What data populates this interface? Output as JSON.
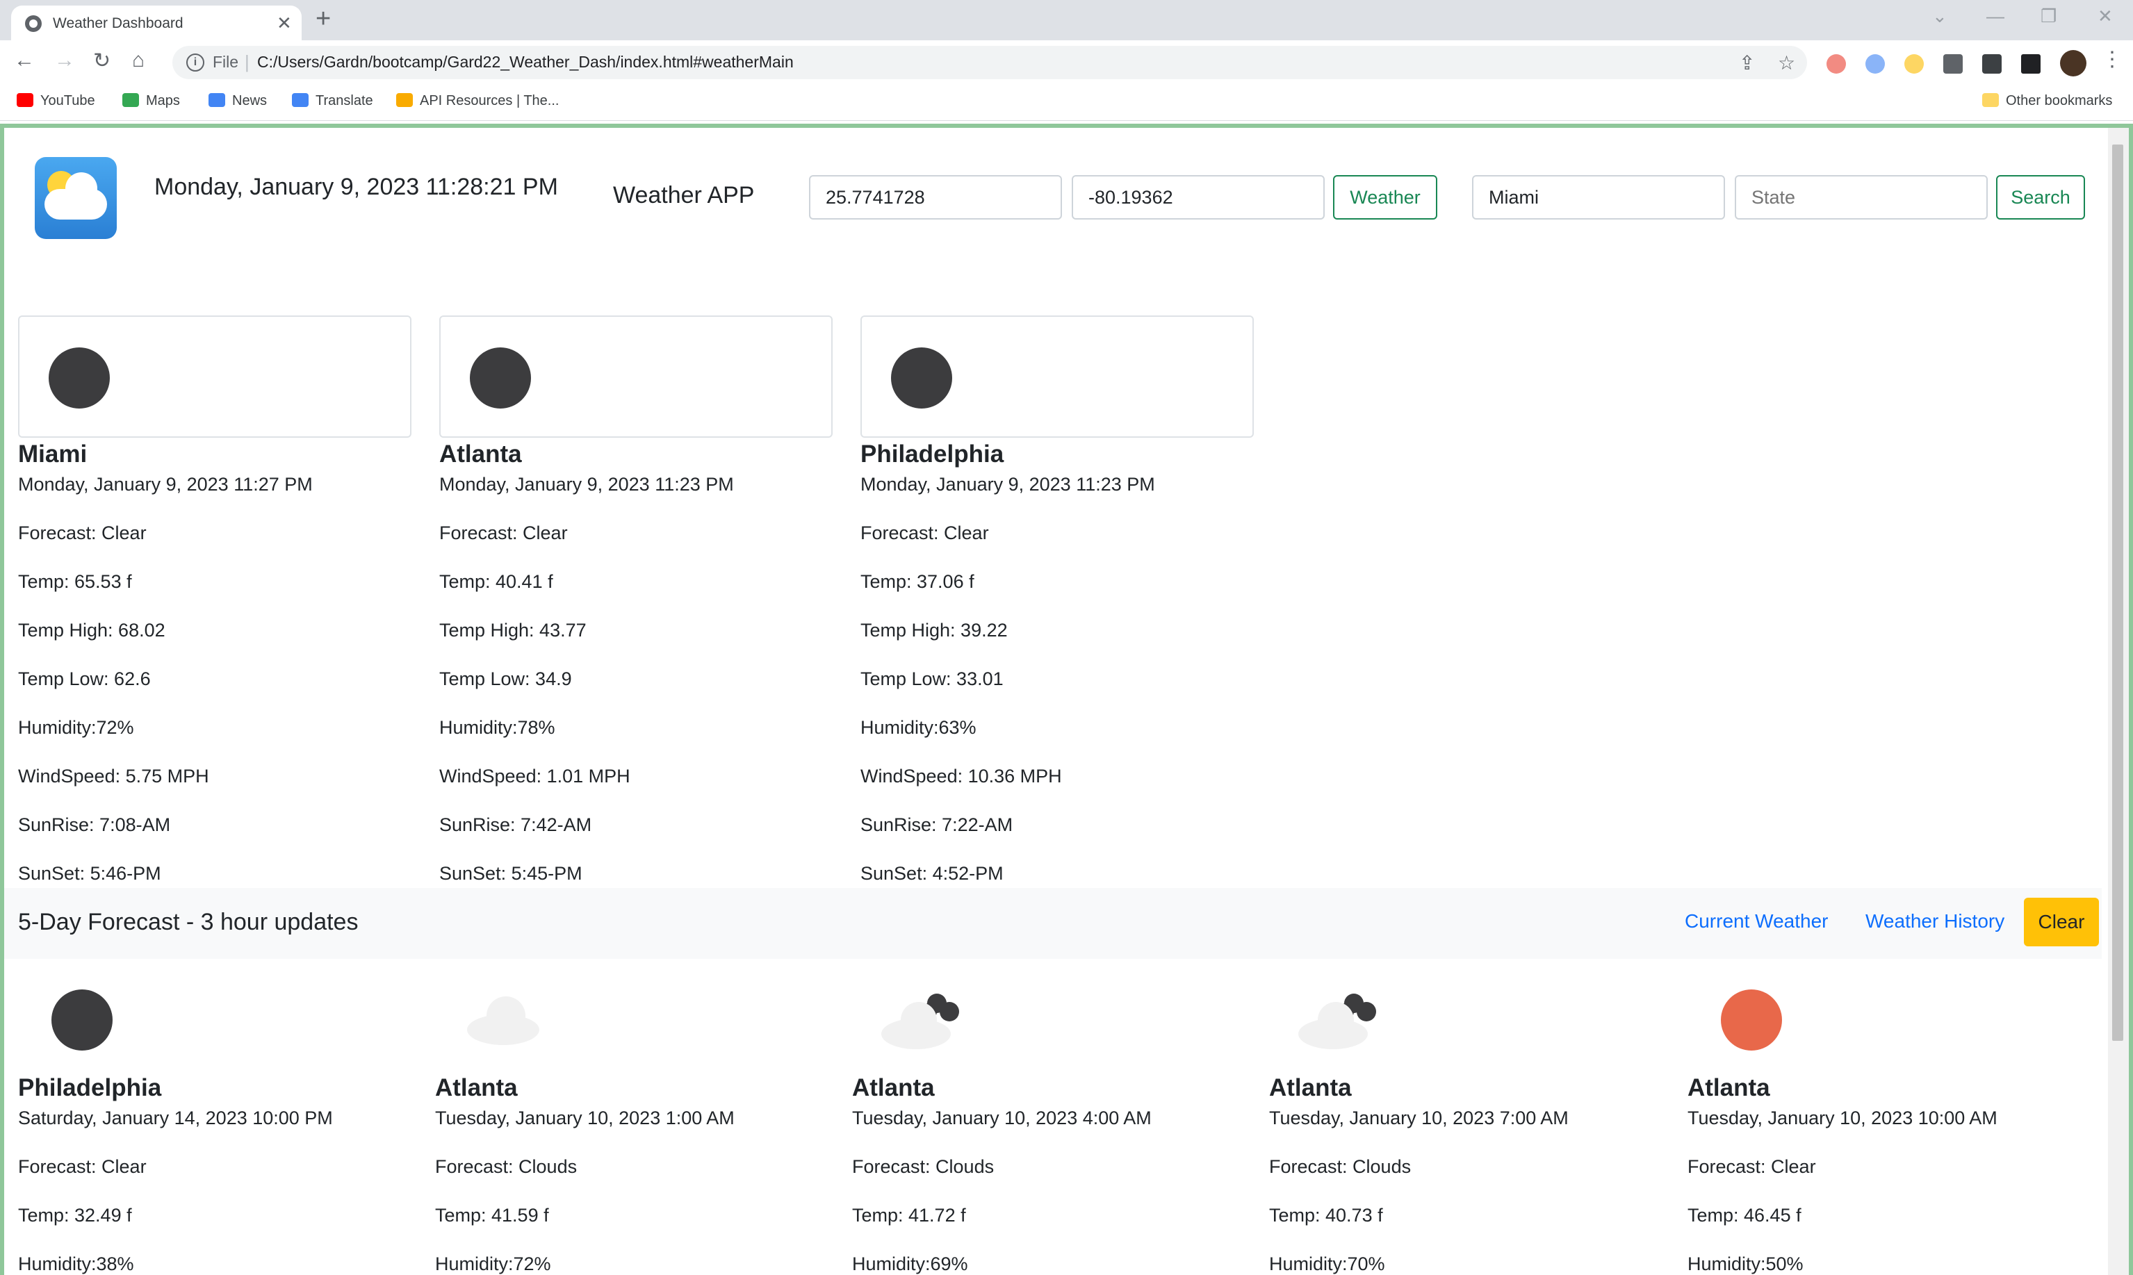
{
  "browser": {
    "tab_title": "Weather Dashboard",
    "tab_close": "✕",
    "new_tab": "+",
    "omnibox_file": "File",
    "url": "C:/Users/Gardn/bootcamp/Gard22_Weather_Dash/index.html#weatherMain",
    "bookmarks": [
      "YouTube",
      "Maps",
      "News",
      "Translate",
      "API Resources | The..."
    ],
    "other_bookmarks": "Other bookmarks"
  },
  "header": {
    "datetime": "Monday, January 9, 2023 11:28:21 PM",
    "app_title": "Weather APP",
    "lat_value": "25.7741728",
    "lon_value": "-80.19362",
    "weather_button": "Weather",
    "city_value": "Miami",
    "state_placeholder": "State",
    "search_button": "Search"
  },
  "current_cards": [
    {
      "city": "Miami",
      "date": "Monday, January 9, 2023 11:27 PM",
      "forecast": "Forecast: Clear",
      "temp": "Temp: 65.53 f",
      "temp_high": "Temp High: 68.02",
      "temp_low": "Temp Low: 62.6",
      "humidity": "Humidity:72%",
      "wind": "WindSpeed: 5.75 MPH",
      "sunrise": "SunRise: 7:08-AM",
      "sunset": "SunSet: 5:46-PM",
      "icon": "moon-icon"
    },
    {
      "city": "Atlanta",
      "date": "Monday, January 9, 2023 11:23 PM",
      "forecast": "Forecast: Clear",
      "temp": "Temp: 40.41 f",
      "temp_high": "Temp High: 43.77",
      "temp_low": "Temp Low: 34.9",
      "humidity": "Humidity:78%",
      "wind": "WindSpeed: 1.01 MPH",
      "sunrise": "SunRise: 7:42-AM",
      "sunset": "SunSet: 5:45-PM",
      "icon": "moon-icon"
    },
    {
      "city": "Philadelphia",
      "date": "Monday, January 9, 2023 11:23 PM",
      "forecast": "Forecast: Clear",
      "temp": "Temp: 37.06 f",
      "temp_high": "Temp High: 39.22",
      "temp_low": "Temp Low: 33.01",
      "humidity": "Humidity:63%",
      "wind": "WindSpeed: 10.36 MPH",
      "sunrise": "SunRise: 7:22-AM",
      "sunset": "SunSet: 4:52-PM",
      "icon": "moon-icon"
    }
  ],
  "forecast_bar": {
    "title": "5-Day Forecast - 3 hour updates",
    "current_weather_link": "Current Weather",
    "weather_history_link": "Weather History",
    "clear_button": "Clear"
  },
  "forecast_cards": [
    {
      "city": "Philadelphia",
      "date": "Saturday, January 14, 2023 10:00 PM",
      "forecast": "Forecast: Clear",
      "temp": "Temp: 32.49 f",
      "humidity": "Humidity:38%",
      "icon": "moon-icon"
    },
    {
      "city": "Atlanta",
      "date": "Tuesday, January 10, 2023 1:00 AM",
      "forecast": "Forecast: Clouds",
      "temp": "Temp: 41.59 f",
      "humidity": "Humidity:72%",
      "icon": "cloud-icon"
    },
    {
      "city": "Atlanta",
      "date": "Tuesday, January 10, 2023 4:00 AM",
      "forecast": "Forecast: Clouds",
      "temp": "Temp: 41.72 f",
      "humidity": "Humidity:69%",
      "icon": "dark-clouds-icon"
    },
    {
      "city": "Atlanta",
      "date": "Tuesday, January 10, 2023 7:00 AM",
      "forecast": "Forecast: Clouds",
      "temp": "Temp: 40.73 f",
      "humidity": "Humidity:70%",
      "icon": "dark-clouds-icon"
    },
    {
      "city": "Atlanta",
      "date": "Tuesday, January 10, 2023 10:00 AM",
      "forecast": "Forecast: Clear",
      "temp": "Temp: 46.45 f",
      "humidity": "Humidity:50%",
      "icon": "sun-icon"
    }
  ],
  "colors": {
    "accent_green": "#198754",
    "link_blue": "#0d6efd",
    "warning_yellow": "#ffc107",
    "viewport_border": "#8fc79a"
  }
}
